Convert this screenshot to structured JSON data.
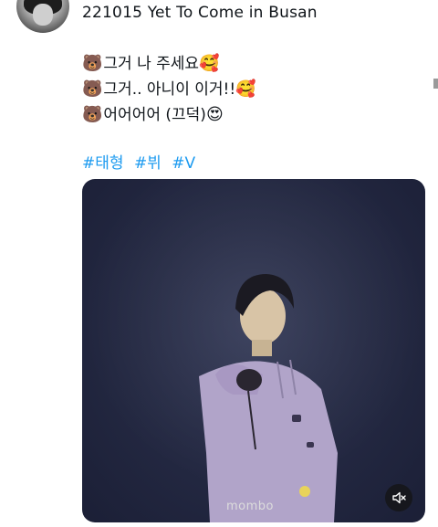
{
  "post": {
    "title": "221015 Yet To Come in Busan",
    "lines": [
      {
        "text": "그거 나 주세요 ",
        "lead_emoji": "🐻",
        "trail_emoji": "🥰"
      },
      {
        "text": "그거.. 아니이 이거!!",
        "lead_emoji": "🐻",
        "trail_emoji": "🥰"
      },
      {
        "text": "어어어어 (끄덕)",
        "lead_emoji": "🐻",
        "trail_emoji": "😍"
      }
    ],
    "hashtags": [
      "#태형",
      "#뷔",
      "#V"
    ],
    "hashtag_color": "#1d9bf0"
  },
  "media": {
    "watermark": "mombo",
    "background_color": "#252a44",
    "mute_icon": "speaker-muted-icon"
  }
}
